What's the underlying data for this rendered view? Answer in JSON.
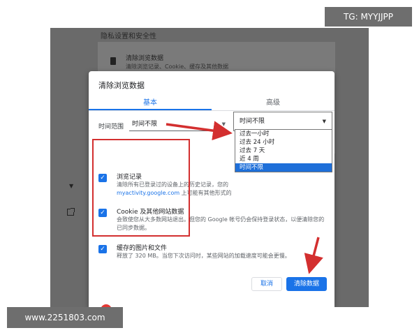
{
  "background_page": {
    "section_title": "隐私设置和安全性",
    "row_title": "清除浏览数据",
    "row_subtitle": "清除浏览记录、Cookie、缓存及其他数据"
  },
  "dialog": {
    "title": "清除浏览数据",
    "tabs": [
      {
        "label": "基本",
        "active": true
      },
      {
        "label": "高级",
        "active": false
      }
    ],
    "time_range": {
      "label": "时间范围",
      "value": "时间不限"
    },
    "items": [
      {
        "title": "浏览记录",
        "desc_line1": "清除所有已登录过的设备上的历史记录，您的",
        "desc_link": "myactivity.google.com",
        "desc_line2": " 上可能有其他形式的",
        "checked": true
      },
      {
        "title": "Cookie 及其他网站数据",
        "desc": "会致使您从大多数网站退出。但您的 Google 帐号仍会保持登录状态，以便清除您的已同步数据。",
        "checked": true
      },
      {
        "title": "缓存的图片和文件",
        "desc": "释放了 320 MB。当您下次访问时，某些网站的加载速度可能会更慢。",
        "checked": true
      }
    ],
    "cancel_label": "取消",
    "clear_label": "清除数据"
  },
  "dropdown": {
    "value": "时间不限",
    "options": [
      {
        "label": "过去一小时",
        "selected": false
      },
      {
        "label": "过去 24 小时",
        "selected": false
      },
      {
        "label": "过去 7 天",
        "selected": false
      },
      {
        "label": "近 4 周",
        "selected": false
      },
      {
        "label": "时间不限",
        "selected": true
      }
    ]
  },
  "watermarks": {
    "top_right": "TG: MYYJJPP",
    "bottom_left": "www.2251803.com"
  },
  "colors": {
    "accent": "#1a73e8",
    "annotation": "#d32f2f",
    "selected_option": "#1e6fd9"
  },
  "icons": [
    "trash-icon",
    "dropdown-caret-icon",
    "checkmark-icon",
    "open-in-new-icon",
    "annotation-arrow-icon"
  ]
}
